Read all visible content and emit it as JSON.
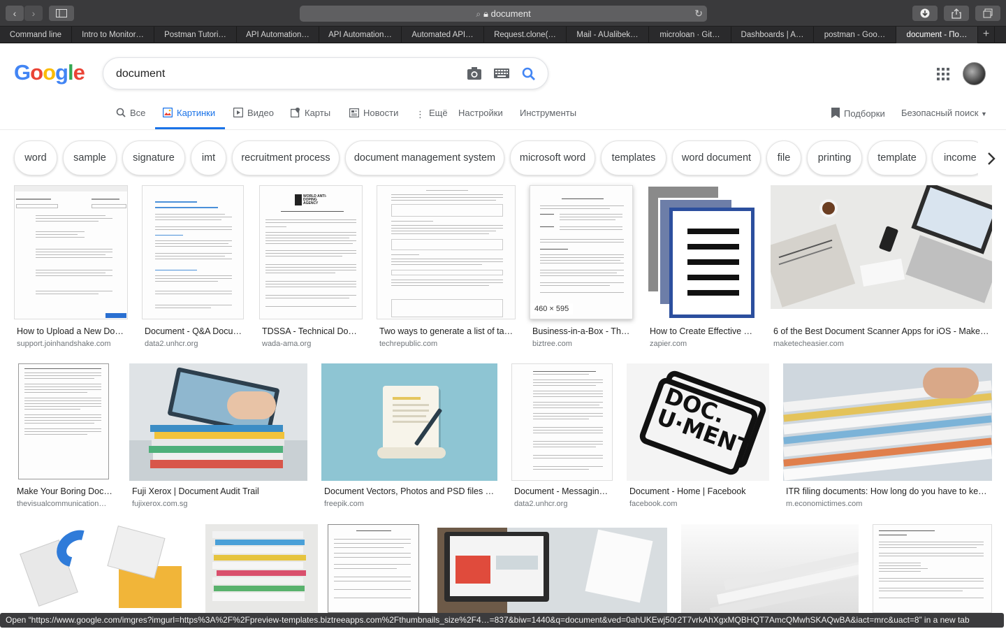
{
  "browser": {
    "address": "document",
    "tabs": [
      "Command line",
      "Intro to Monitor…",
      "Postman Tutori…",
      "API Automation…",
      "API Automation…",
      "Automated API…",
      "Request.clone(…",
      "Mail - AUalibek…",
      "microloan · Git…",
      "Dashboards | A…",
      "postman - Goo…",
      "document - По…"
    ],
    "status_text": "Open “https://www.google.com/imgres?imgurl=https%3A%2F%2Fpreview-templates.biztreeapps.com%2Fthumbnails_size%2F4…=837&biw=1440&q=document&ved=0ahUKEwj50r2T7vrkAhXgxMQBHQT7AmcQMwhSKAQwBA&iact=mrc&uact=8” in a new tab"
  },
  "google": {
    "logo": "Google",
    "query": "document"
  },
  "nav": {
    "all": "Все",
    "images": "Картинки",
    "videos": "Видео",
    "maps": "Карты",
    "news": "Новости",
    "more": "Ещё",
    "settings": "Настройки",
    "tools": "Инструменты",
    "collections": "Подборки",
    "safesearch": "Безопасный поиск"
  },
  "chips": [
    "word",
    "sample",
    "signature",
    "imt",
    "recruitment process",
    "document management system",
    "microsoft word",
    "templates",
    "word document",
    "file",
    "printing",
    "template",
    "income t"
  ],
  "results": [
    {
      "title": "How to Upload a New Do…",
      "source": "support.joinhandshake.com"
    },
    {
      "title": "Document - Q&A Docu…",
      "source": "data2.unhcr.org"
    },
    {
      "title": "TDSSA - Technical Do…",
      "source": "wada-ama.org"
    },
    {
      "title": "Two ways to generate a list of ta…",
      "source": "techrepublic.com"
    },
    {
      "title": "Business-in-a-Box - Th…",
      "source": "biztree.com",
      "dimensions": "460 × 595"
    },
    {
      "title": "How to Create Effective …",
      "source": "zapier.com"
    },
    {
      "title": "6 of the Best Document Scanner Apps for iOS - Make…",
      "source": "maketecheasier.com"
    },
    {
      "title": "Make Your Boring Doc…",
      "source": "thevisualcommunication…"
    },
    {
      "title": "Fuji Xerox | Document Audit Trail",
      "source": "fujixerox.com.sg"
    },
    {
      "title": "Document Vectors, Photos and PSD files …",
      "source": "freepik.com"
    },
    {
      "title": "Document - Messagin…",
      "source": "data2.unhcr.org"
    },
    {
      "title": "Document - Home | Facebook",
      "source": "facebook.com"
    },
    {
      "title": "ITR filing documents: How long do you have to ke…",
      "source": "m.economictimes.com"
    }
  ],
  "thumb_text": {
    "wada": "WORLD ANTI-DOPING AGENCY",
    "facebook_stamp_1": "DOC.",
    "facebook_stamp_2": "U·MENT"
  }
}
